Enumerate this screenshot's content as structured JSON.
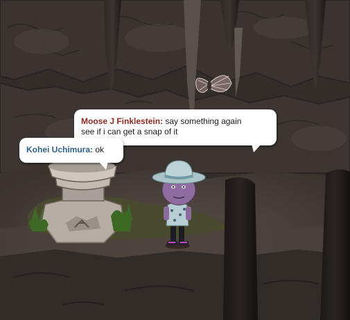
{
  "chat": {
    "messages": [
      {
        "speaker": "Moose J Finklestein:",
        "text_line1": "say something again",
        "text_line2": "see if i can get a snap of it",
        "speaker_color": "#8b2a22"
      },
      {
        "speaker": "Kohei Uchimura:",
        "text": "ok",
        "speaker_color": "#2f5f86"
      }
    ]
  },
  "scene": {
    "setting": "cave",
    "objects": [
      "stalactites",
      "stone-pedestal",
      "moth",
      "player-avatar",
      "grass-patch"
    ]
  }
}
